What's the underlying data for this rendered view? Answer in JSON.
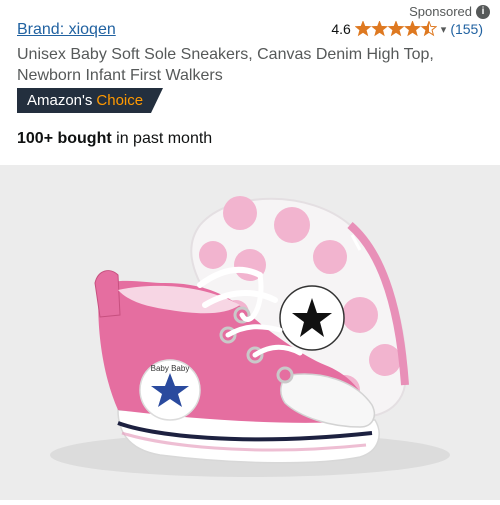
{
  "sponsored": {
    "label": "Sponsored",
    "icon": "info-icon",
    "icon_glyph": "i"
  },
  "brand": {
    "label": "Brand: xioqen"
  },
  "rating": {
    "value": "4.6",
    "stars": 4.5,
    "star_color": "#de7921",
    "count": "(155)"
  },
  "product": {
    "title": "Unisex Baby Soft Sole Sneakers, Canvas Denim High Top, Newborn Infant First Walkers",
    "badge": {
      "prefix": "Amazon's",
      "accent": "Choice"
    },
    "bought": {
      "strong": "100+ bought",
      "rest": "in past month"
    },
    "image": {
      "description_icon": "baby-sneakers-image",
      "patch_text": "Baby Baby"
    }
  }
}
